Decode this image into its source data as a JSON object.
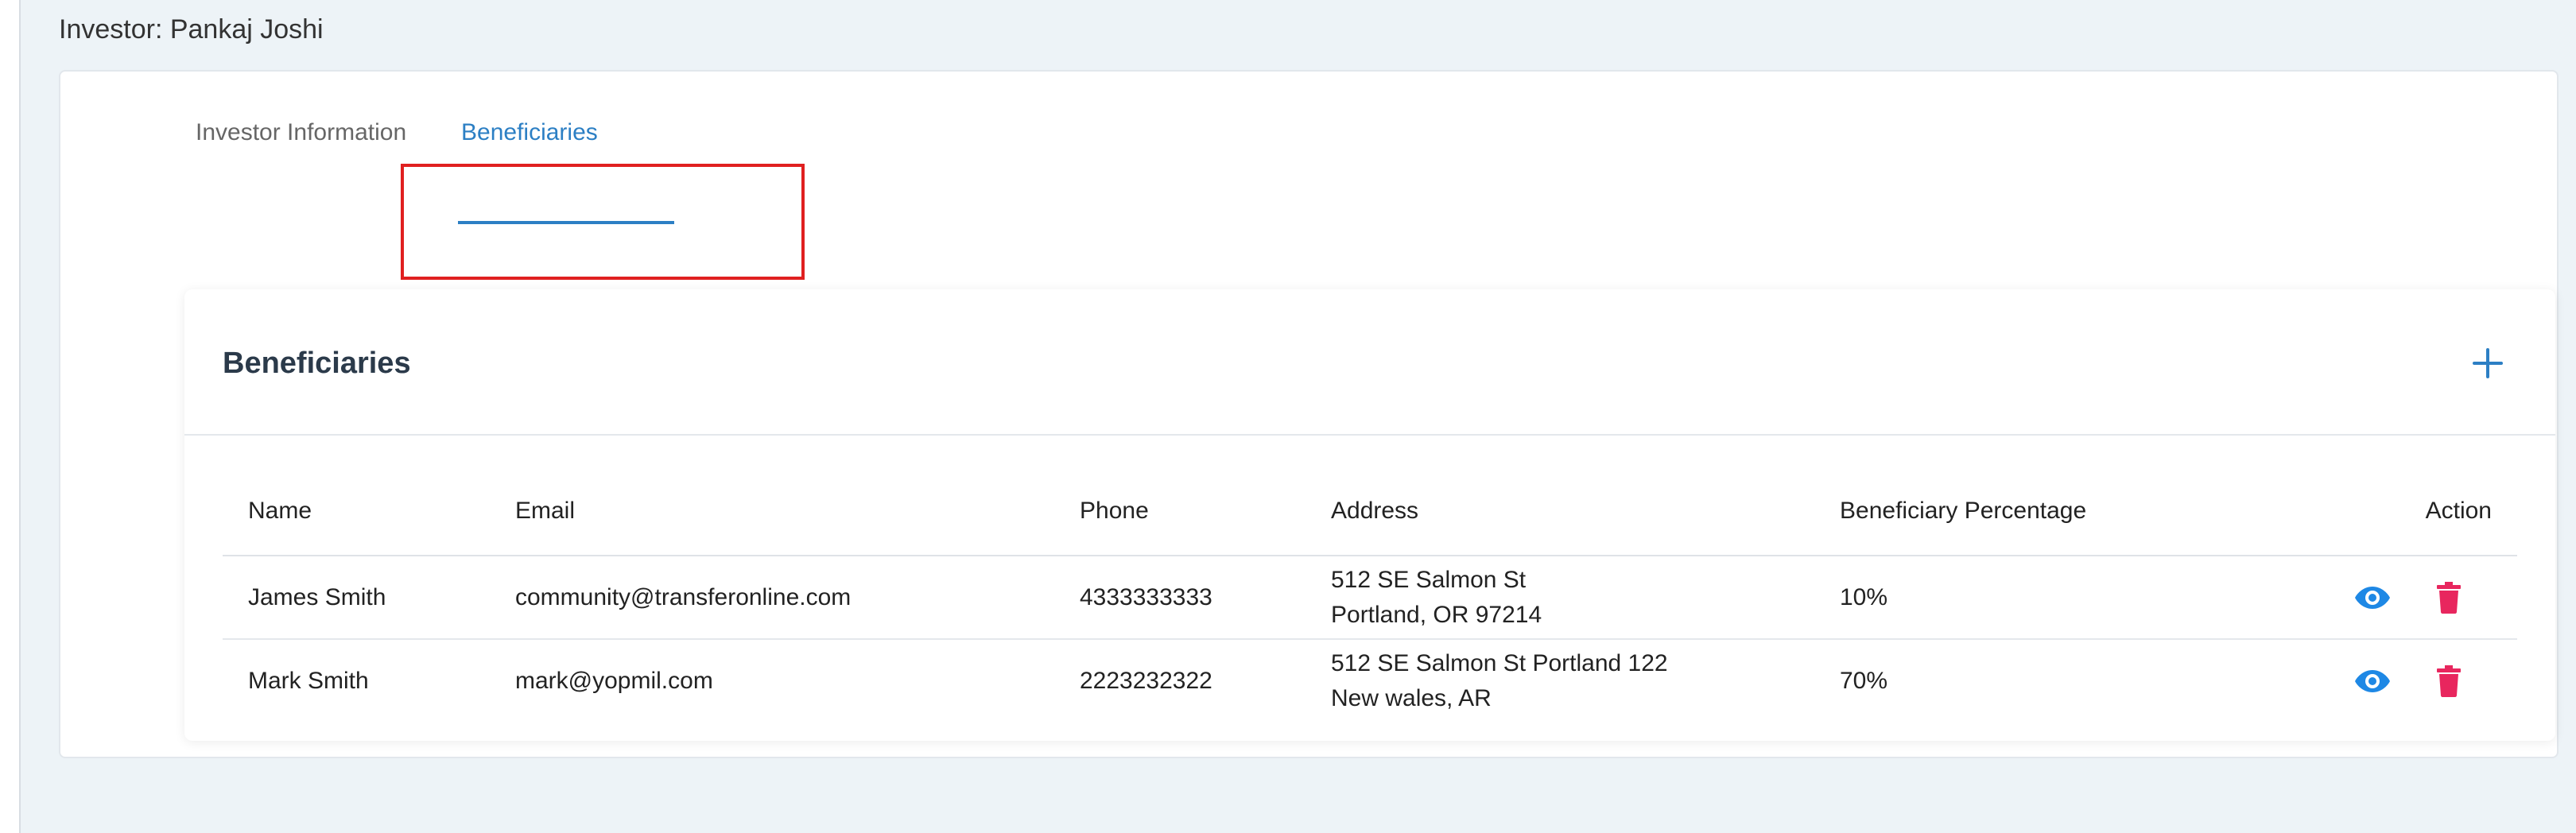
{
  "page": {
    "title": "Investor: Pankaj Joshi"
  },
  "tabs": [
    {
      "label": "Investor Information",
      "active": false
    },
    {
      "label": "Beneficiaries",
      "active": true
    }
  ],
  "beneficiaries": {
    "title": "Beneficiaries",
    "add_icon": "plus-icon",
    "columns": {
      "name": "Name",
      "email": "Email",
      "phone": "Phone",
      "address": "Address",
      "percentage": "Beneficiary Percentage",
      "action": "Action"
    },
    "rows": [
      {
        "name": "James Smith",
        "email": "community@transferonline.com",
        "phone": "4333333333",
        "address_line1": "512 SE Salmon St",
        "address_line2": "Portland, OR 97214",
        "percentage": "10%"
      },
      {
        "name": "Mark Smith",
        "email": "mark@yopmil.com",
        "phone": "2223232322",
        "address_line1": "512 SE Salmon St Portland 122",
        "address_line2": "New wales, AR",
        "percentage": "70%"
      }
    ],
    "view_icon": "eye-icon",
    "delete_icon": "trash-icon"
  },
  "colors": {
    "accent": "#2c7fc4",
    "delete": "#e8265e",
    "view": "#1e88e5",
    "highlight": "#e02020",
    "page_bg": "#edf3f7"
  }
}
